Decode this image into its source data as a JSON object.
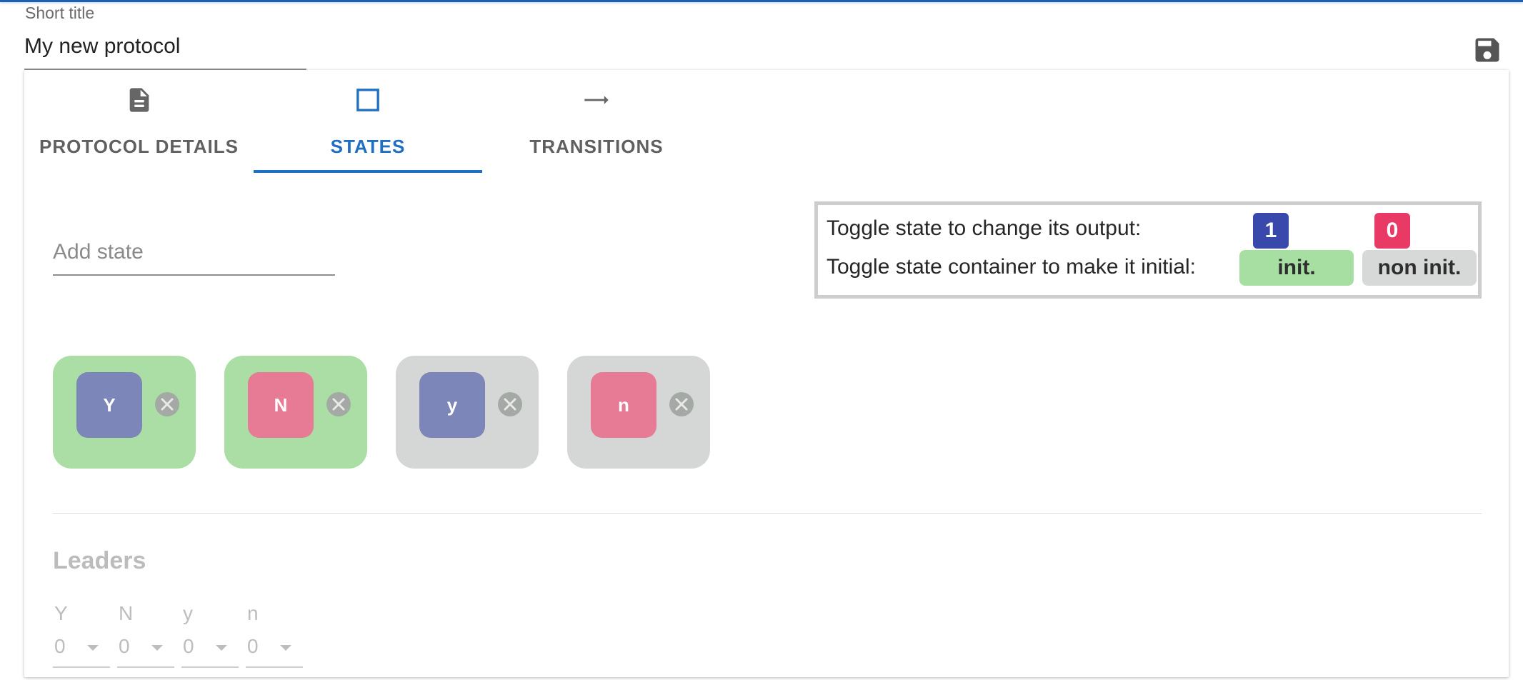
{
  "header": {
    "short_title_label": "Short title",
    "short_title_value": "My new protocol",
    "save_icon": "save-icon"
  },
  "tabs": [
    {
      "label": "PROTOCOL DETAILS",
      "icon": "document-icon",
      "active": false
    },
    {
      "label": "STATES",
      "icon": "square-outline-icon",
      "active": true
    },
    {
      "label": "TRANSITIONS",
      "icon": "arrow-right-icon",
      "active": false
    }
  ],
  "states_panel": {
    "add_state_placeholder": "Add state",
    "legend": {
      "output_text": "Toggle state to change its output:",
      "output_one": "1",
      "output_zero": "0",
      "initial_text": "Toggle state container to make it initial:",
      "initial_label": "init.",
      "non_initial_label": "non init."
    },
    "states": [
      {
        "name": "Y",
        "output": 1,
        "initial": true
      },
      {
        "name": "N",
        "output": 0,
        "initial": true
      },
      {
        "name": "y",
        "output": 1,
        "initial": false
      },
      {
        "name": "n",
        "output": 0,
        "initial": false
      }
    ],
    "remove_icon": "close-circle-icon"
  },
  "leaders": {
    "title": "Leaders",
    "items": [
      {
        "label": "Y",
        "value": "0"
      },
      {
        "label": "N",
        "value": "0"
      },
      {
        "label": "y",
        "value": "0"
      },
      {
        "label": "n",
        "value": "0"
      }
    ]
  },
  "colors": {
    "accent": "#1f6fc3",
    "output_one": "#3949ab",
    "output_zero": "#e83a65",
    "initial": "#a7dfa2",
    "non_initial": "#d7d9d9"
  }
}
